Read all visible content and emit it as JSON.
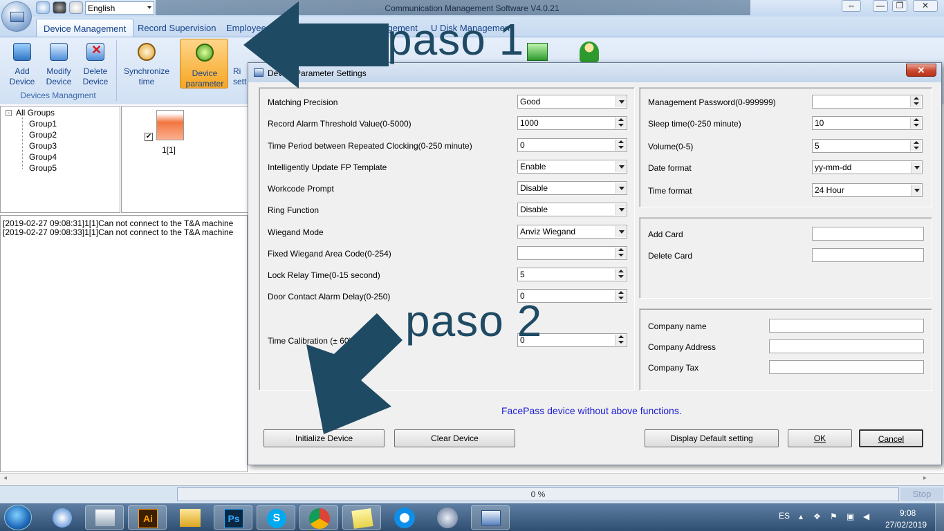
{
  "window": {
    "title": "Communication Management Software V4.0.21",
    "language": "English",
    "controls": [
      "⇔",
      "—",
      "❐",
      "✕"
    ]
  },
  "tabs": [
    {
      "label": "Device Management",
      "active": true
    },
    {
      "label": "Record Supervision"
    },
    {
      "label": "Employee"
    },
    {
      "label": "Management"
    },
    {
      "label": "U Disk Management"
    }
  ],
  "ribbon": {
    "buttons": [
      {
        "label1": "Add",
        "label2": "Device",
        "icon": "add-device-icon"
      },
      {
        "label1": "Modify",
        "label2": "Device",
        "icon": "modify-device-icon"
      },
      {
        "label1": "Delete",
        "label2": "Device",
        "icon": "delete-device-icon"
      },
      {
        "label1": "Synchronize",
        "label2": "time",
        "icon": "clock-icon"
      },
      {
        "label1": "Device",
        "label2": "parameter",
        "icon": "gear-icon",
        "active": true
      },
      {
        "label1": "Ri",
        "label2": "sett",
        "icon": "bell-icon"
      }
    ],
    "group_label": "Devices Managment"
  },
  "tree": {
    "root": "All Groups",
    "groups": [
      "Group1",
      "Group2",
      "Group3",
      "Group4",
      "Group5"
    ]
  },
  "device_tile": {
    "label": "1[1]",
    "checked": true
  },
  "log": [
    "[2019-02-27 09:08:31]1[1]Can not connect to the T&A machine",
    "[2019-02-27 09:08:33]1[1]Can not connect to the T&A machine"
  ],
  "status": {
    "progress": "0 %",
    "stop": "Stop"
  },
  "dialog": {
    "title": "Device Parameter Settings",
    "close": "✕",
    "left_fields": [
      {
        "label": "Matching Precision",
        "value": "Good",
        "type": "dropdown"
      },
      {
        "label": "Record Alarm Threshold Value(0-5000)",
        "value": "1000",
        "type": "spin"
      },
      {
        "label": "Time Period between Repeated Clocking(0-250 minute)",
        "value": "0",
        "type": "spin"
      },
      {
        "label": "Intelligently Update FP Template",
        "value": "Enable",
        "type": "dropdown"
      },
      {
        "label": "Workcode Prompt",
        "value": "Disable",
        "type": "dropdown"
      },
      {
        "label": "Ring Function",
        "value": "Disable",
        "type": "dropdown"
      },
      {
        "label": "Wiegand Mode",
        "value": "Anviz Wiegand",
        "type": "dropdown"
      },
      {
        "label": "Fixed Wiegand Area Code(0-254)",
        "value": "",
        "type": "spin"
      },
      {
        "label": "Lock Relay Time(0-15 second)",
        "value": "5",
        "type": "spin"
      },
      {
        "label": "Door Contact Alarm Delay(0-250)",
        "value": "0",
        "type": "spin"
      },
      {
        "label": "Time Calibration (± 60):",
        "value": "0",
        "type": "spin"
      }
    ],
    "right_top_fields": [
      {
        "label": "Management Password(0-999999)",
        "value": "",
        "type": "spin"
      },
      {
        "label": "Sleep time(0-250 minute)",
        "value": "10",
        "type": "spin"
      },
      {
        "label": "Volume(0-5)",
        "value": "5",
        "type": "spin"
      },
      {
        "label": "Date format",
        "value": "yy-mm-dd",
        "type": "dropdown"
      },
      {
        "label": "Time format",
        "value": "24 Hour",
        "type": "dropdown"
      }
    ],
    "card_fields": [
      {
        "label": "Add Card",
        "value": ""
      },
      {
        "label": "Delete Card",
        "value": ""
      }
    ],
    "company_fields": [
      {
        "label": "Company name",
        "value": ""
      },
      {
        "label": "Company Address",
        "value": ""
      },
      {
        "label": "Company Tax",
        "value": ""
      }
    ],
    "note": "FacePass device without above functions.",
    "buttons": {
      "initialize": "Initialize Device",
      "clear": "Clear Device",
      "default": "Display Default setting",
      "ok": "OK",
      "cancel": "Cancel"
    }
  },
  "annotations": {
    "step1": "paso 1",
    "step2": "paso 2"
  },
  "taskbar": {
    "apps": [
      "outlook-icon",
      "illustrator-icon",
      "explorer-icon",
      "photoshop-icon",
      "skype-icon",
      "chrome-icon",
      "sticky-notes-icon",
      "teamviewer-icon",
      "clock-app-icon",
      "comm-software-icon"
    ],
    "lang": "ES",
    "time": "9:08",
    "date": "27/02/2019"
  },
  "colors": {
    "accent": "#1f4a63",
    "note": "#1a1ad2",
    "ribbon_active": "#f5a623"
  }
}
